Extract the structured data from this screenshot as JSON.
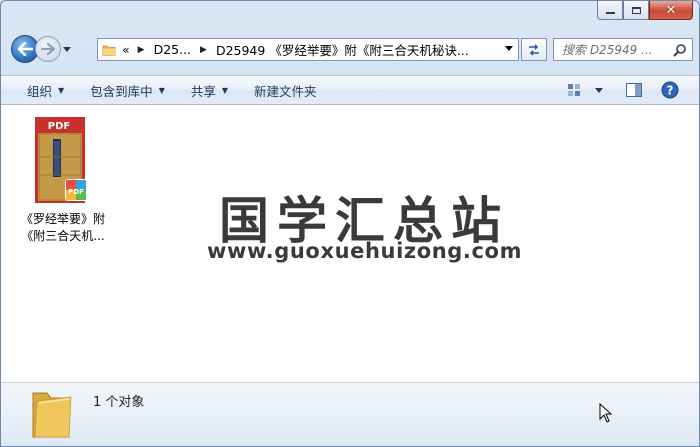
{
  "window": {
    "minimize_icon": "minimize-icon",
    "maximize_icon": "maximize-icon",
    "close_icon": "close-icon",
    "close_glyph": "✕"
  },
  "address_bar": {
    "overflow": "«",
    "segments": [
      "D25...",
      "D25949 《罗经举要》附《附三合天机秘诀..."
    ],
    "search_placeholder": "搜索 D25949 ..."
  },
  "command_bar": {
    "organize": "组织",
    "include_in_library": "包含到库中",
    "share": "共享",
    "new_folder": "新建文件夹"
  },
  "content": {
    "items": [
      {
        "name_line1": "《罗经举要》附",
        "name_line2": "《附三合天机...",
        "type": "PDF"
      }
    ],
    "watermark_cn": "国学汇总站",
    "watermark_url": "www.guoxuehuizong.com"
  },
  "details": {
    "count": "1 个对象"
  },
  "colors": {
    "accent": "#1e395b",
    "pdf_red": "#c9302c",
    "folder_yellow": "#f1c65a"
  }
}
